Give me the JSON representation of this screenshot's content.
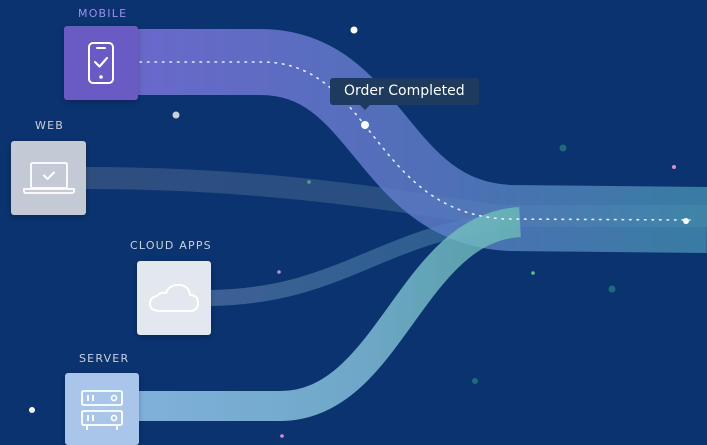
{
  "sources": [
    {
      "id": "mobile",
      "label": "MOBILE",
      "icon": "smartphone-check-icon",
      "tile_color": "#6a5ac4",
      "label_color": "#9b8ff0",
      "flow_color": "#6f6bd0"
    },
    {
      "id": "web",
      "label": "WEB",
      "icon": "laptop-check-icon",
      "tile_color": "#c3cad6",
      "label_color": "#c9d1dd",
      "flow_color": "#8896b0"
    },
    {
      "id": "cloud",
      "label": "CLOUD APPS",
      "icon": "cloud-icon",
      "tile_color": "#e3e7ee",
      "label_color": "#c9d1dd",
      "flow_color": "#7b93b8"
    },
    {
      "id": "server",
      "label": "SERVER",
      "icon": "server-icon",
      "tile_color": "#a9c6ea",
      "label_color": "#c9d1dd",
      "flow_color": "#8fbde0"
    }
  ],
  "event": {
    "label": "Order Completed"
  },
  "destination": {
    "flow_color": "#4fa98e"
  },
  "colors": {
    "background": "#0b3370",
    "tooltip_bg": "#1e3a5c"
  }
}
